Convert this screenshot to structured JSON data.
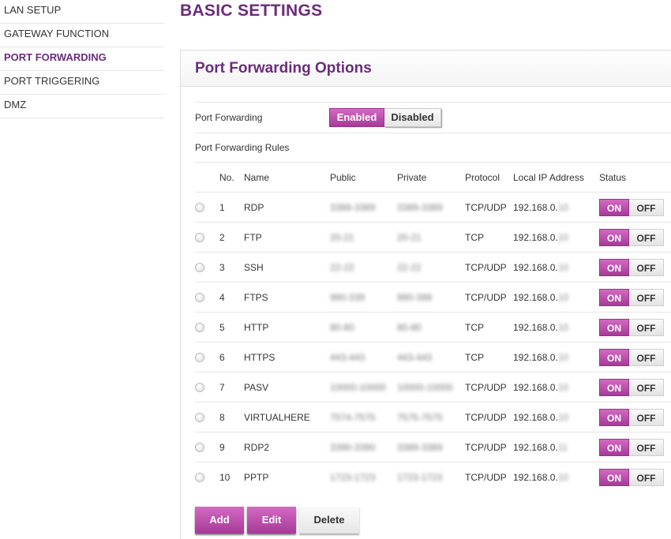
{
  "sidebar": {
    "items": [
      {
        "label": "LAN SETUP"
      },
      {
        "label": "GATEWAY FUNCTION"
      },
      {
        "label": "PORT FORWARDING"
      },
      {
        "label": "PORT TRIGGERING"
      },
      {
        "label": "DMZ"
      }
    ],
    "active_index": 2
  },
  "page_title": "BASIC SETTINGS",
  "panel": {
    "title": "Port Forwarding Options",
    "port_forwarding_label": "Port Forwarding",
    "enabled_label": "Enabled",
    "disabled_label": "Disabled",
    "selected_state": "Enabled",
    "rules_label": "Port Forwarding Rules"
  },
  "table": {
    "headers": {
      "no": "No.",
      "name": "Name",
      "public": "Public",
      "private": "Private",
      "protocol": "Protocol",
      "ip": "Local IP Address",
      "status": "Status"
    },
    "rows": [
      {
        "no": "1",
        "name": "RDP",
        "public": "3389-3389",
        "private": "3389-3389",
        "protocol": "TCP/UDP",
        "ip_prefix": "192.168.0.",
        "ip_last": "10",
        "on": "ON",
        "off": "OFF"
      },
      {
        "no": "2",
        "name": "FTP",
        "public": "20-21",
        "private": "20-21",
        "protocol": "TCP",
        "ip_prefix": "192.168.0.",
        "ip_last": "10",
        "on": "ON",
        "off": "OFF"
      },
      {
        "no": "3",
        "name": "SSH",
        "public": "22-22",
        "private": "22-22",
        "protocol": "TCP/UDP",
        "ip_prefix": "192.168.0.",
        "ip_last": "10",
        "on": "ON",
        "off": "OFF"
      },
      {
        "no": "4",
        "name": "FTPS",
        "public": "990-339",
        "private": "990-399",
        "protocol": "TCP/UDP",
        "ip_prefix": "192.168.0.",
        "ip_last": "10",
        "on": "ON",
        "off": "OFF"
      },
      {
        "no": "5",
        "name": "HTTP",
        "public": "80-80",
        "private": "80-80",
        "protocol": "TCP",
        "ip_prefix": "192.168.0.",
        "ip_last": "10",
        "on": "ON",
        "off": "OFF"
      },
      {
        "no": "6",
        "name": "HTTPS",
        "public": "443-443",
        "private": "443-443",
        "protocol": "TCP",
        "ip_prefix": "192.168.0.",
        "ip_last": "10",
        "on": "ON",
        "off": "OFF"
      },
      {
        "no": "7",
        "name": "PASV",
        "public": "10000-10000",
        "private": "10000-10000",
        "protocol": "TCP/UDP",
        "ip_prefix": "192.168.0.",
        "ip_last": "10",
        "on": "ON",
        "off": "OFF"
      },
      {
        "no": "8",
        "name": "VIRTUALHERE",
        "public": "7574-7575",
        "private": "7575-7575",
        "protocol": "TCP/UDP",
        "ip_prefix": "192.168.0.",
        "ip_last": "10",
        "on": "ON",
        "off": "OFF"
      },
      {
        "no": "9",
        "name": "RDP2",
        "public": "3390-3390",
        "private": "3389-3389",
        "protocol": "TCP/UDP",
        "ip_prefix": "192.168.0.",
        "ip_last": "11",
        "on": "ON",
        "off": "OFF"
      },
      {
        "no": "10",
        "name": "PPTP",
        "public": "1723-1723",
        "private": "1723-1723",
        "protocol": "TCP/UDP",
        "ip_prefix": "192.168.0.",
        "ip_last": "10",
        "on": "ON",
        "off": "OFF"
      }
    ]
  },
  "buttons": {
    "add": "Add",
    "edit": "Edit",
    "delete": "Delete"
  },
  "colors": {
    "accent": "#6b2c7a",
    "button_magenta": "#b84aab"
  }
}
